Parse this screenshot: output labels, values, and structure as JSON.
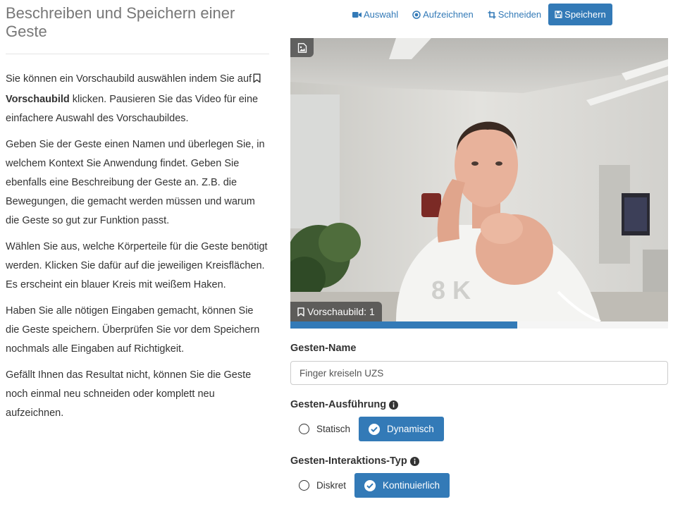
{
  "left": {
    "title": "Beschreiben und Speichern einer Geste",
    "p1_before": "Sie können ein Vorschaubild auswählen indem Sie auf",
    "p1_bold": "Vorschaubild",
    "p1_after": " klicken. Pausieren Sie das Video für eine einfachere Auswahl des Vorschaubildes.",
    "p2": "Geben Sie der Geste einen Namen und überlegen Sie, in welchem Kontext Sie Anwendung findet. Geben Sie ebenfalls eine Beschreibung der Geste an. Z.B. die Bewegungen, die gemacht werden müssen und warum die Geste so gut zur Funktion passt.",
    "p3": "Wählen Sie aus, welche Körperteile für die Geste benötigt werden. Klicken Sie dafür auf die jeweiligen Kreisflächen. Es erscheint ein blauer Kreis mit weißem Haken.",
    "p4": "Haben Sie alle nötigen Eingaben gemacht, können Sie die Geste speichern. Überprüfen Sie vor dem Speichern nochmals alle Eingaben auf Richtigkeit.",
    "p5": "Gefällt Ihnen das Resultat nicht, können Sie die Geste noch einmal neu schneiden oder komplett neu aufzeichnen."
  },
  "toolbar": {
    "select_label": "Auswahl",
    "record_label": "Aufzeichnen",
    "crop_label": "Schneiden",
    "save_label": "Speichern"
  },
  "video": {
    "thumbnail_label": "Vorschaubild: 1",
    "progress_fraction": 0.6
  },
  "form": {
    "name_label": "Gesten-Name",
    "name_value": "Finger kreiseln UZS",
    "execution_label": "Gesten-Ausführung",
    "execution_options": [
      "Statisch",
      "Dynamisch"
    ],
    "execution_selected": "Dynamisch",
    "interaction_label": "Gesten-Interaktions-Typ",
    "interaction_options": [
      "Diskret",
      "Kontinuierlich"
    ],
    "interaction_selected": "Kontinuierlich"
  },
  "colors": {
    "primary": "#337ab7",
    "muted_title": "#777777",
    "text": "#333333"
  },
  "icons": [
    "video-camera-icon",
    "record-icon",
    "crop-icon",
    "floppy-disk-icon",
    "image-icon",
    "bookmark-icon",
    "info-circle-icon",
    "check-circle-icon"
  ]
}
